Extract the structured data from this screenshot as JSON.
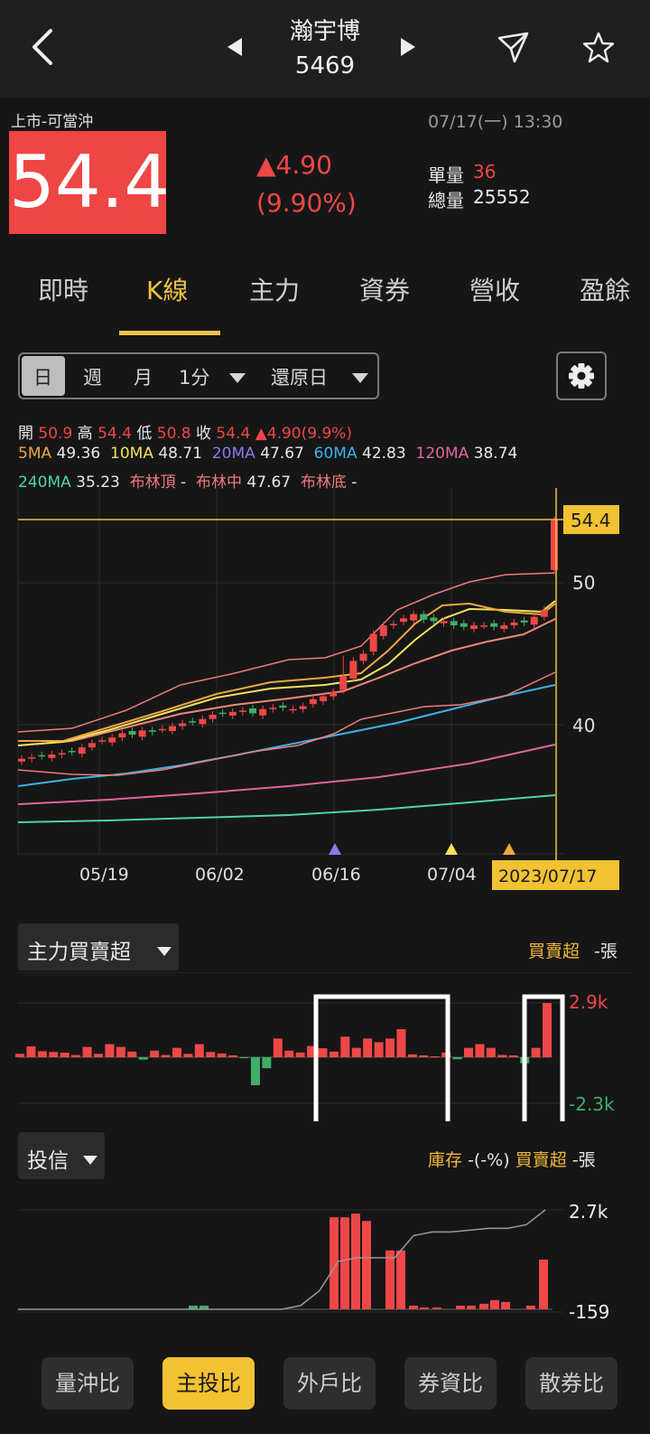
{
  "header": {
    "stock_name": "瀚宇博",
    "stock_code": "5469"
  },
  "quote": {
    "market_tag": "上市-可當沖",
    "datetime": "07/17(一) 13:30",
    "price": "54.4",
    "change": "▲4.90",
    "change_pct": "(9.90%)",
    "single_volume_label": "單量",
    "single_volume": "36",
    "total_volume_label": "總量",
    "total_volume": "25552"
  },
  "tabs": [
    "即時",
    "K線",
    "主力",
    "資券",
    "營收",
    "盈餘"
  ],
  "period_selector": {
    "day": "日",
    "week": "週",
    "month": "月",
    "minute": "1分",
    "restore": "還原日"
  },
  "ohlc": {
    "open_label": "開",
    "open": "50.9",
    "high_label": "高",
    "high": "54.4",
    "low_label": "低",
    "low": "50.8",
    "close_label": "收",
    "close": "54.4",
    "change": "▲4.90(9.9%)"
  },
  "ma": {
    "ma5_label": "5MA",
    "ma5": "49.36",
    "ma10_label": "10MA",
    "ma10": "48.71",
    "ma20_label": "20MA",
    "ma20": "47.67",
    "ma60_label": "60MA",
    "ma60": "42.83",
    "ma120_label": "120MA",
    "ma120": "38.74",
    "ma240_label": "240MA",
    "ma240": "35.23",
    "boll_top_label": "布林頂",
    "boll_top": "-",
    "boll_mid_label": "布林中",
    "boll_mid": "47.67",
    "boll_bottom_label": "布林底",
    "boll_bottom": "-"
  },
  "chart_data": [
    {
      "type": "candlestick",
      "y_ticks": [
        "50",
        "40"
      ],
      "price_marker": "54.4",
      "x_ticks": [
        "05/19",
        "06/02",
        "06/16",
        "07/04"
      ],
      "selected_date": "2023/07/17",
      "close_series_approx": [
        37.6,
        37.7,
        37.8,
        37.9,
        38.0,
        38.1,
        38.4,
        38.7,
        38.9,
        39.1,
        39.4,
        39.3,
        39.6,
        39.5,
        39.7,
        39.9,
        40.1,
        40.2,
        40.4,
        40.7,
        40.8,
        40.9,
        41.0,
        40.8,
        41.1,
        41.2,
        41.2,
        41.1,
        41.3,
        41.8,
        42.0,
        42.3,
        43.4,
        44.5,
        45.0,
        46.4,
        47.0,
        47.1,
        47.5,
        47.8,
        47.4,
        47.3,
        47.3,
        47.0,
        46.9,
        47.0,
        47.0,
        46.9,
        47.0,
        47.2,
        47.2,
        47.6,
        48.1,
        54.4
      ]
    },
    {
      "type": "bar",
      "title": "主力買賣超",
      "legend_label": "買賣超",
      "unit": "-張",
      "y_max_label": "2.9k",
      "y_min_label": "-2.3k",
      "values": [
        0.18,
        0.58,
        0.32,
        0.28,
        0.24,
        0.12,
        0.55,
        0.18,
        0.7,
        0.55,
        0.3,
        -0.12,
        0.35,
        0.12,
        0.5,
        0.18,
        0.7,
        0.28,
        0.2,
        0.1,
        -0.05,
        -1.4,
        -0.55,
        1.0,
        0.35,
        0.25,
        0.6,
        0.48,
        0.3,
        1.1,
        0.5,
        1.0,
        0.8,
        1.0,
        1.5,
        0.15,
        0.1,
        0.05,
        0.25,
        -0.1,
        0.5,
        0.7,
        0.5,
        0.12,
        0.1,
        -0.3,
        0.5,
        2.9
      ]
    },
    {
      "type": "bar",
      "title": "投信",
      "legend_labels": [
        "庫存",
        "-(-%)",
        "買賣超",
        "-張"
      ],
      "y_max_label": "2.7k",
      "y_min_label": "-159",
      "values": [
        0.1,
        0.1,
        2.5,
        2.5,
        2.6,
        2.4,
        1.6,
        1.6,
        0.1,
        0.05,
        0.05,
        0.1,
        0.1,
        0.15,
        0.25,
        0.2,
        0.1,
        1.35
      ],
      "inventory_line_approx": [
        0,
        0,
        0,
        0,
        0,
        0,
        0,
        0,
        0,
        0,
        0,
        0,
        0,
        0,
        0,
        0.1,
        0.5,
        1.3,
        1.4,
        1.4,
        1.4,
        2.0,
        2.1,
        2.1,
        2.15,
        2.2,
        2.2,
        2.3,
        2.7
      ]
    }
  ],
  "subpanel1": {
    "dropdown": "主力買賣超",
    "legend": "買賣超",
    "unit": "-張",
    "max": "2.9k",
    "min": "-2.3k"
  },
  "subpanel2": {
    "dropdown": "投信",
    "inventory_label": "庫存",
    "inventory_value": "-(-%)",
    "legend": "買賣超",
    "unit": "-張",
    "max": "2.7k",
    "min": "-159"
  },
  "bottom_buttons": [
    "量沖比",
    "主投比",
    "外戶比",
    "券資比",
    "散券比"
  ],
  "colors": {
    "up": "#ef4747",
    "down": "#3fae6a",
    "accent": "#f0c244",
    "bg": "#161616"
  }
}
